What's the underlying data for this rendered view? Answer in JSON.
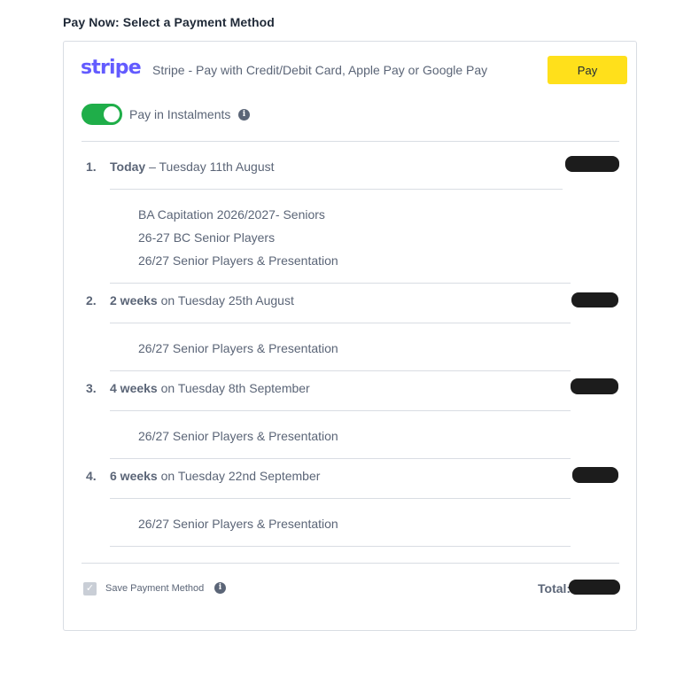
{
  "page_title": "Pay Now: Select a Payment Method",
  "stripe": {
    "logo_text": "stripe",
    "description": "Stripe - Pay with Credit/Debit Card, Apple Pay or Google Pay",
    "pay_label": "Pay"
  },
  "instalments_toggle": {
    "label": "Pay in Instalments",
    "enabled": true
  },
  "instalments": [
    {
      "number": "1.",
      "when": "Today",
      "date": " – Tuesday 11th August",
      "items": [
        "BA Capitation 2026/2027- Seniors",
        "26-27 BC Senior Players",
        "26/27 Senior Players & Presentation"
      ]
    },
    {
      "number": "2.",
      "when": "2 weeks",
      "date": " on Tuesday 25th August",
      "items": [
        "26/27 Senior Players & Presentation"
      ]
    },
    {
      "number": "3.",
      "when": "4 weeks",
      "date": " on Tuesday 8th September",
      "items": [
        "26/27 Senior Players & Presentation"
      ]
    },
    {
      "number": "4.",
      "when": "6 weeks",
      "date": " on Tuesday 22nd September",
      "items": [
        "26/27 Senior Players & Presentation"
      ]
    }
  ],
  "footer": {
    "save_label": "Save Payment Method",
    "save_checked": true,
    "total_label": "Total:"
  },
  "colors": {
    "stripe_brand": "#635bff",
    "pay_button": "#ffe01b",
    "toggle_on": "#1fae49"
  }
}
